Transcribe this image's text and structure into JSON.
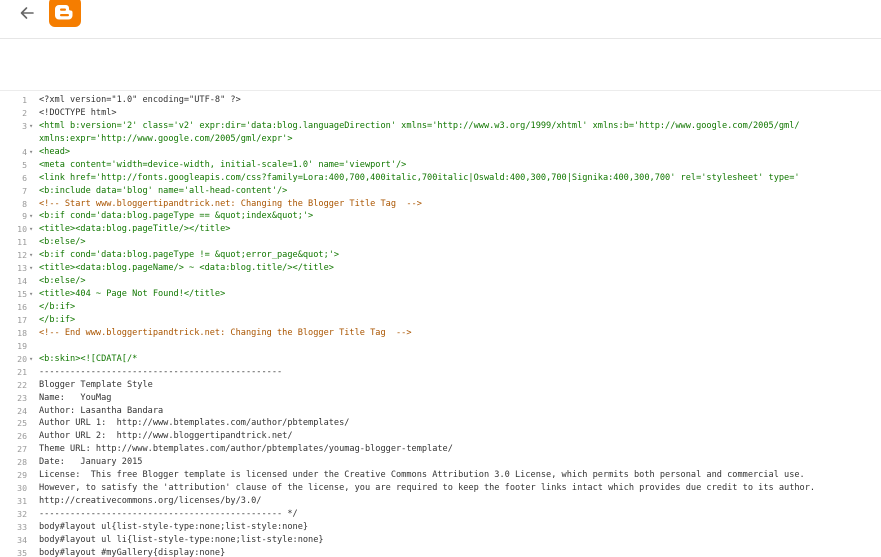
{
  "header": {
    "back_icon": "arrow-left-icon",
    "logo_icon": "blogger-logo-icon",
    "logo_color": "#f57d00"
  },
  "editor": {
    "lines": [
      {
        "n": "1",
        "fold": "",
        "kind": "text",
        "text": "<?xml version=\"1.0\" encoding=\"UTF-8\" ?>"
      },
      {
        "n": "2",
        "fold": "",
        "kind": "text",
        "text": "<!DOCTYPE html>"
      },
      {
        "n": "3",
        "fold": "▾",
        "kind": "tag",
        "text": "<html b:version='2' class='v2' expr:dir='data:blog.languageDirection' xmlns='http://www.w3.org/1999/xhtml' xmlns:b='http://www.google.com/2005/gml/"
      },
      {
        "n": "",
        "fold": "",
        "kind": "tag",
        "text": "xmlns:expr='http://www.google.com/2005/gml/expr'>"
      },
      {
        "n": "4",
        "fold": "▾",
        "kind": "tag",
        "text": "<head>"
      },
      {
        "n": "5",
        "fold": "",
        "kind": "tag",
        "text": "<meta content='width=device-width, initial-scale=1.0' name='viewport'/>"
      },
      {
        "n": "6",
        "fold": "",
        "kind": "tag",
        "text": "<link href='http://fonts.googleapis.com/css?family=Lora:400,700,400italic,700italic|Oswald:400,300,700|Signika:400,300,700' rel='stylesheet' type='"
      },
      {
        "n": "7",
        "fold": "",
        "kind": "tag",
        "text": "<b:include data='blog' name='all-head-content'/>"
      },
      {
        "n": "8",
        "fold": "",
        "kind": "comment",
        "text": "<!-- Start www.bloggertipandtrick.net: Changing the Blogger Title Tag  -->"
      },
      {
        "n": "9",
        "fold": "▾",
        "kind": "tag",
        "text": "<b:if cond='data:blog.pageType == &quot;index&quot;'>"
      },
      {
        "n": "10",
        "fold": "▾",
        "kind": "tag",
        "text": "<title><data:blog.pageTitle/></title>"
      },
      {
        "n": "11",
        "fold": "",
        "kind": "tag",
        "text": "<b:else/>"
      },
      {
        "n": "12",
        "fold": "▾",
        "kind": "tag",
        "text": "<b:if cond='data:blog.pageType != &quot;error_page&quot;'>"
      },
      {
        "n": "13",
        "fold": "▾",
        "kind": "tag",
        "text": "<title><data:blog.pageName/> ~ <data:blog.title/></title>"
      },
      {
        "n": "14",
        "fold": "",
        "kind": "tag",
        "text": "<b:else/>"
      },
      {
        "n": "15",
        "fold": "▾",
        "kind": "tag",
        "text": "<title>404 ~ Page Not Found!</title>"
      },
      {
        "n": "16",
        "fold": "",
        "kind": "tag",
        "text": "</b:if>"
      },
      {
        "n": "17",
        "fold": "",
        "kind": "tag",
        "text": "</b:if>"
      },
      {
        "n": "18",
        "fold": "",
        "kind": "comment",
        "text": "<!-- End www.bloggertipandtrick.net: Changing the Blogger Title Tag  -->"
      },
      {
        "n": "19",
        "fold": "",
        "kind": "text",
        "text": ""
      },
      {
        "n": "20",
        "fold": "▾",
        "kind": "tag",
        "text": "<b:skin><![CDATA[/*"
      },
      {
        "n": "21",
        "fold": "",
        "kind": "text",
        "text": "-----------------------------------------------"
      },
      {
        "n": "22",
        "fold": "",
        "kind": "text",
        "text": "Blogger Template Style"
      },
      {
        "n": "23",
        "fold": "",
        "kind": "text",
        "text": "Name:   YouMag"
      },
      {
        "n": "24",
        "fold": "",
        "kind": "text",
        "text": "Author: Lasantha Bandara"
      },
      {
        "n": "25",
        "fold": "",
        "kind": "text",
        "text": "Author URL 1:  http://www.btemplates.com/author/pbtemplates/"
      },
      {
        "n": "26",
        "fold": "",
        "kind": "text",
        "text": "Author URL 2:  http://www.bloggertipandtrick.net/"
      },
      {
        "n": "27",
        "fold": "",
        "kind": "text",
        "text": "Theme URL: http://www.btemplates.com/author/pbtemplates/youmag-blogger-template/"
      },
      {
        "n": "28",
        "fold": "",
        "kind": "text",
        "text": "Date:   January 2015"
      },
      {
        "n": "29",
        "fold": "",
        "kind": "text",
        "text": "License:  This free Blogger template is licensed under the Creative Commons Attribution 3.0 License, which permits both personal and commercial use."
      },
      {
        "n": "30",
        "fold": "",
        "kind": "text",
        "text": "However, to satisfy the 'attribution' clause of the license, you are required to keep the footer links intact which provides due credit to its author."
      },
      {
        "n": "31",
        "fold": "",
        "kind": "text",
        "text": "http://creativecommons.org/licenses/by/3.0/"
      },
      {
        "n": "32",
        "fold": "",
        "kind": "text",
        "text": "----------------------------------------------- */"
      },
      {
        "n": "33",
        "fold": "",
        "kind": "text",
        "text": "body#layout ul{list-style-type:none;list-style:none}"
      },
      {
        "n": "34",
        "fold": "",
        "kind": "text",
        "text": "body#layout ul li{list-style-type:none;list-style:none}"
      },
      {
        "n": "35",
        "fold": "",
        "kind": "text",
        "text": "body#layout #myGallery{display:none}"
      }
    ]
  }
}
